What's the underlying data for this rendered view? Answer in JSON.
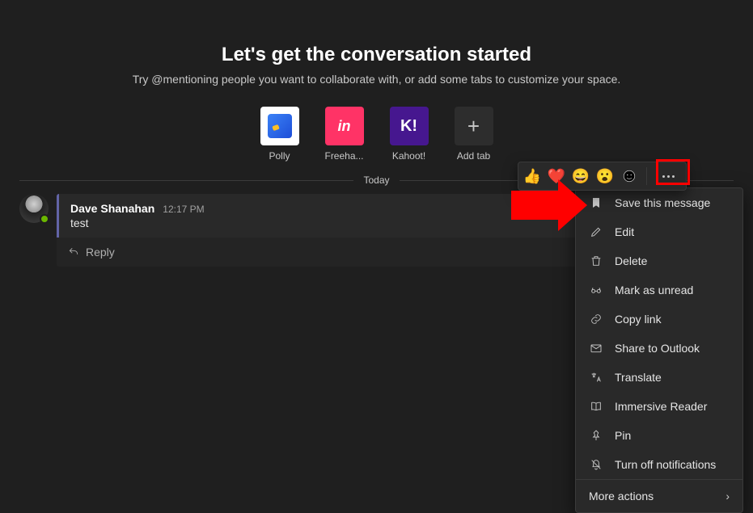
{
  "header": {
    "title": "Let's get the conversation started",
    "subtitle": "Try @mentioning people you want to collaborate with, or add some tabs to customize your space."
  },
  "tabs": [
    {
      "name": "polly",
      "label": "Polly"
    },
    {
      "name": "freehand",
      "label": "Freeha..."
    },
    {
      "name": "kahoot",
      "label": "Kahoot!"
    },
    {
      "name": "add",
      "label": "Add tab"
    }
  ],
  "divider": {
    "label": "Today"
  },
  "message": {
    "author": "Dave Shanahan",
    "time": "12:17 PM",
    "text": "test",
    "reply_label": "Reply"
  },
  "reactions": {
    "like": "👍",
    "heart": "❤️",
    "laugh": "😄",
    "surprised": "😮"
  },
  "menu": {
    "items": [
      {
        "key": "save",
        "label": "Save this message"
      },
      {
        "key": "edit",
        "label": "Edit"
      },
      {
        "key": "delete",
        "label": "Delete"
      },
      {
        "key": "unread",
        "label": "Mark as unread"
      },
      {
        "key": "copylink",
        "label": "Copy link"
      },
      {
        "key": "share",
        "label": "Share to Outlook"
      },
      {
        "key": "translate",
        "label": "Translate"
      },
      {
        "key": "immersive",
        "label": "Immersive Reader"
      },
      {
        "key": "pin",
        "label": "Pin"
      },
      {
        "key": "turnoff",
        "label": "Turn off notifications"
      }
    ],
    "more": "More actions"
  }
}
